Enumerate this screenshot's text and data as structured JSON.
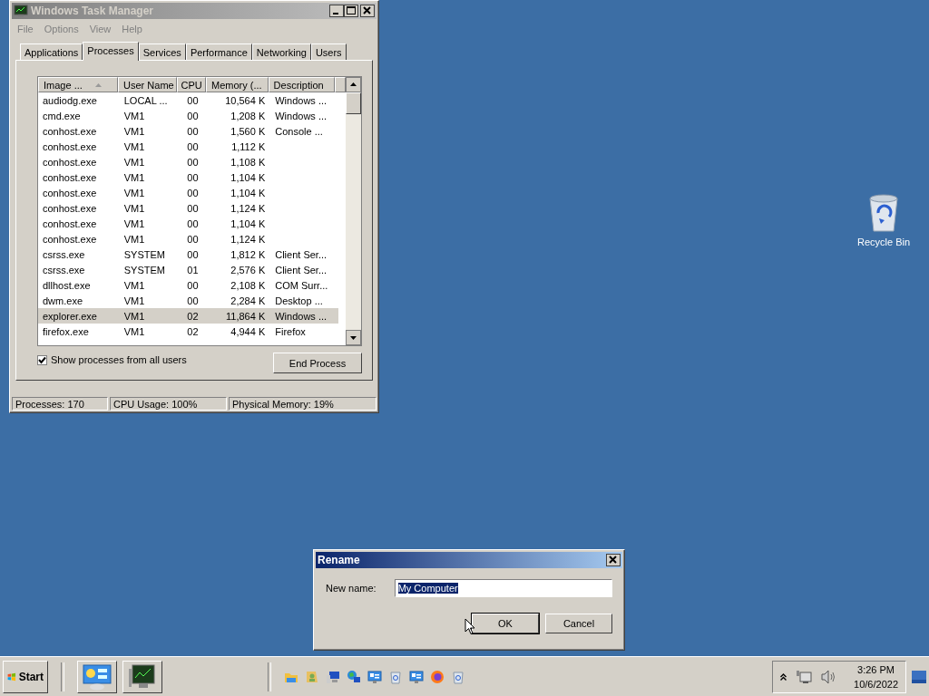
{
  "task_manager": {
    "title": "Windows Task Manager",
    "menu": [
      "File",
      "Options",
      "View",
      "Help"
    ],
    "tabs": [
      {
        "label": "Applications",
        "selected": false
      },
      {
        "label": "Processes",
        "selected": true
      },
      {
        "label": "Services",
        "selected": false
      },
      {
        "label": "Performance",
        "selected": false
      },
      {
        "label": "Networking",
        "selected": false
      },
      {
        "label": "Users",
        "selected": false
      }
    ],
    "columns": [
      "Image ...",
      "User Name",
      "CPU",
      "Memory (...",
      "Description"
    ],
    "rows": [
      {
        "cells": [
          "audiodg.exe",
          "LOCAL ...",
          "00",
          "10,564 K",
          "Windows ..."
        ],
        "selected": false
      },
      {
        "cells": [
          "cmd.exe",
          "VM1",
          "00",
          "1,208 K",
          "Windows ..."
        ],
        "selected": false
      },
      {
        "cells": [
          "conhost.exe",
          "VM1",
          "00",
          "1,560 K",
          "Console ..."
        ],
        "selected": false
      },
      {
        "cells": [
          "conhost.exe",
          "VM1",
          "00",
          "1,112 K",
          ""
        ],
        "selected": false
      },
      {
        "cells": [
          "conhost.exe",
          "VM1",
          "00",
          "1,108 K",
          ""
        ],
        "selected": false
      },
      {
        "cells": [
          "conhost.exe",
          "VM1",
          "00",
          "1,104 K",
          ""
        ],
        "selected": false
      },
      {
        "cells": [
          "conhost.exe",
          "VM1",
          "00",
          "1,104 K",
          ""
        ],
        "selected": false
      },
      {
        "cells": [
          "conhost.exe",
          "VM1",
          "00",
          "1,124 K",
          ""
        ],
        "selected": false
      },
      {
        "cells": [
          "conhost.exe",
          "VM1",
          "00",
          "1,104 K",
          ""
        ],
        "selected": false
      },
      {
        "cells": [
          "conhost.exe",
          "VM1",
          "00",
          "1,124 K",
          ""
        ],
        "selected": false
      },
      {
        "cells": [
          "csrss.exe",
          "SYSTEM",
          "00",
          "1,812 K",
          "Client Ser..."
        ],
        "selected": false
      },
      {
        "cells": [
          "csrss.exe",
          "SYSTEM",
          "01",
          "2,576 K",
          "Client Ser..."
        ],
        "selected": false
      },
      {
        "cells": [
          "dllhost.exe",
          "VM1",
          "00",
          "2,108 K",
          "COM Surr..."
        ],
        "selected": false
      },
      {
        "cells": [
          "dwm.exe",
          "VM1",
          "00",
          "2,284 K",
          "Desktop ..."
        ],
        "selected": false
      },
      {
        "cells": [
          "explorer.exe",
          "VM1",
          "02",
          "11,864 K",
          "Windows ..."
        ],
        "selected": true
      },
      {
        "cells": [
          "firefox.exe",
          "VM1",
          "02",
          "4,944 K",
          "Firefox"
        ],
        "selected": false
      }
    ],
    "show_all_users": {
      "label": "Show processes from all users",
      "checked": true
    },
    "end_process": "End Process",
    "status_bar": [
      "Processes: 170",
      "CPU Usage: 100%",
      "Physical Memory: 19%"
    ]
  },
  "desktop_icons": [
    {
      "label": "Recycle Bin"
    }
  ],
  "rename_dialog": {
    "title": "Rename",
    "label": "New name:",
    "value": "My Computer",
    "buttons": [
      "OK",
      "Cancel"
    ]
  },
  "taskbar": {
    "start": "Start",
    "time": "3:26 PM",
    "date": "10/6/2022"
  }
}
